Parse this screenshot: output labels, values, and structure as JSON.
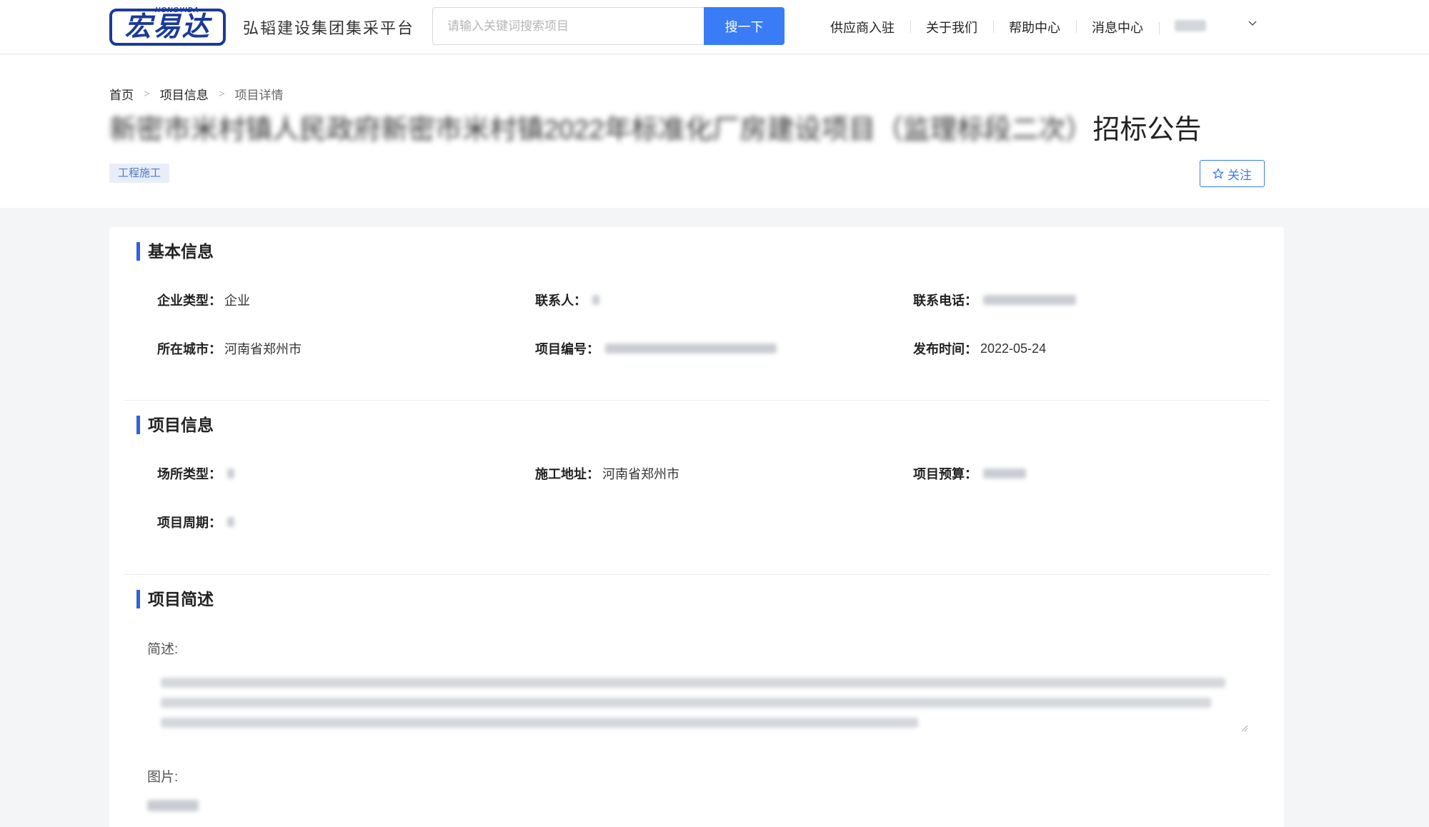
{
  "header": {
    "logo": {
      "sub": "HONGYIDA",
      "main": "宏易达"
    },
    "platform_name": "弘韬建设集团集采平台",
    "search": {
      "placeholder": "请输入关键词搜索项目",
      "button_label": "搜一下"
    },
    "nav": [
      {
        "label": "供应商入驻"
      },
      {
        "label": "关于我们"
      },
      {
        "label": "帮助中心"
      },
      {
        "label": "消息中心"
      }
    ],
    "user_icon": "chevron-down-icon"
  },
  "breadcrumb": {
    "home": "首页",
    "section": "项目信息",
    "current": "项目详情"
  },
  "title": {
    "blurred_part": "新密市米村镇人民政府新密市米村镇2022年标准化厂房建设项目（监理标段二次）",
    "suffix": "招标公告"
  },
  "tag": "工程施工",
  "follow_button": {
    "label": "关注",
    "icon": "star-outline-icon"
  },
  "basic_info": {
    "heading": "基本信息",
    "fields": {
      "company_type": {
        "label": "企业类型：",
        "value": "企业"
      },
      "contact": {
        "label": "联系人："
      },
      "phone": {
        "label": "联系电话："
      },
      "city": {
        "label": "所在城市：",
        "value": "河南省郑州市"
      },
      "project_no": {
        "label": "项目编号："
      },
      "publish_date": {
        "label": "发布时间：",
        "value": "2022-05-24"
      }
    }
  },
  "project_info": {
    "heading": "项目信息",
    "fields": {
      "venue_type": {
        "label": "场所类型："
      },
      "address": {
        "label": "施工地址：",
        "value": "河南省郑州市"
      },
      "budget": {
        "label": "项目预算："
      },
      "period": {
        "label": "项目周期："
      }
    }
  },
  "summary": {
    "heading": "项目简述",
    "desc_label": "简述:",
    "image_label": "图片:"
  },
  "colors": {
    "primary": "#3a7cf5",
    "accent_bar": "#2e62e0",
    "logo": "#1b3a9a",
    "tag_bg": "#e8eef9"
  }
}
